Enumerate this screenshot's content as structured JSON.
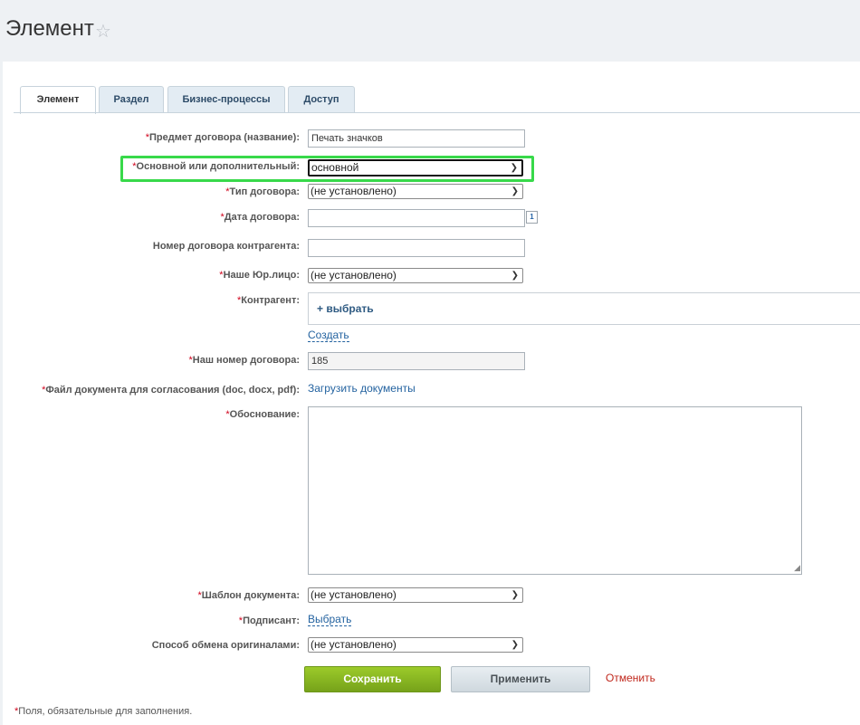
{
  "page": {
    "title": "Элемент"
  },
  "tabs": [
    {
      "label": "Элемент"
    },
    {
      "label": "Раздел"
    },
    {
      "label": "Бизнес-процессы"
    },
    {
      "label": "Доступ"
    }
  ],
  "form": {
    "required_mark": "*",
    "subject": {
      "label": "Предмет договора (название):",
      "value": "Печать значков"
    },
    "main_or_additional": {
      "label": "Основной или дополнительный:",
      "value": "основной"
    },
    "contract_type": {
      "label": "Тип договора:",
      "value": "(не установлено)"
    },
    "contract_date": {
      "label": "Дата договора:",
      "value": "",
      "calendar_icon": "1"
    },
    "counterparty_number": {
      "label": "Номер договора контрагента:",
      "value": ""
    },
    "our_legal_entity": {
      "label": "Наше Юр.лицо:",
      "value": "(не установлено)"
    },
    "counterparty": {
      "label": "Контрагент:",
      "select_label": "+  выбрать",
      "create_link": "Создать"
    },
    "our_number": {
      "label": "Наш номер договора:",
      "value": "185"
    },
    "document_file": {
      "label": "Файл документа для согласования (doc, docx, pdf):",
      "link": "Загрузить документы"
    },
    "justification": {
      "label": "Обоснование:",
      "value": ""
    },
    "document_template": {
      "label": "Шаблон документа:",
      "value": "(не установлено)"
    },
    "signatory": {
      "label": "Подписант:",
      "link": "Выбрать"
    },
    "originals_exchange": {
      "label": "Способ обмена оригиналами:",
      "value": "(не установлено)"
    }
  },
  "buttons": {
    "save": "Сохранить",
    "apply": "Применить",
    "cancel": "Отменить"
  },
  "footnote": {
    "mark": "*",
    "text": "Поля, обязательные для заполнения."
  },
  "colors": {
    "highlight": "#38d94a",
    "required": "#d0021b",
    "save_button": "#8bbd22",
    "link": "#2463a0"
  }
}
